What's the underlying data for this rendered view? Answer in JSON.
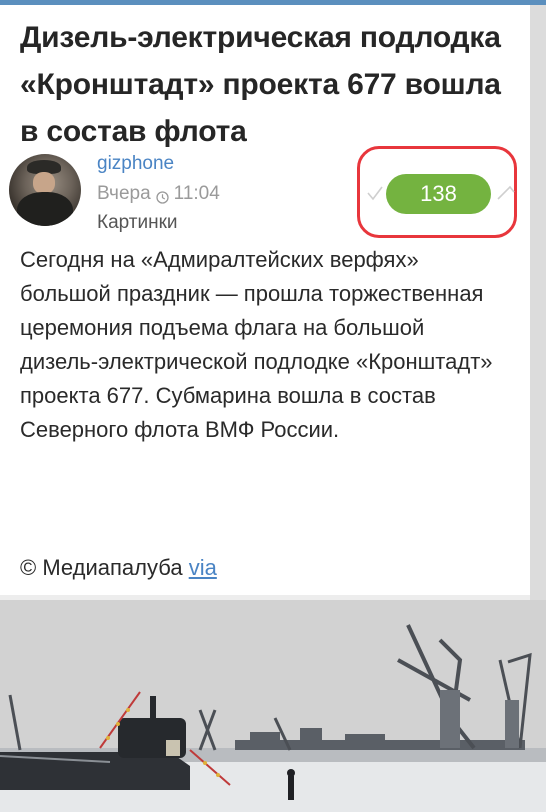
{
  "post": {
    "title": "Дизель-электрическая подлодка «Кронштадт» проекта 677 вошла в состав флота",
    "author": "gizphone",
    "date_label": "Вчера",
    "time": "11:04",
    "hub": "Картинки",
    "score": "138",
    "body": "Сегодня на «Адмиралтейских верфях» большой праздник — прошла торжественная церемония подъема флага на большой дизель-электрической подлодке «Кронштадт» проекта 677. Субмарина вошла в состав Северного флота ВМФ России.",
    "source_prefix": "© Медиапалуба",
    "source_link": "via"
  },
  "icons": {
    "clock": "clock-icon",
    "vote_down": "chevron-down-icon",
    "vote_up": "chevron-up-icon"
  },
  "colors": {
    "score_badge": "#74b340",
    "highlight_box": "#e8363c",
    "link": "#4a84c4"
  }
}
